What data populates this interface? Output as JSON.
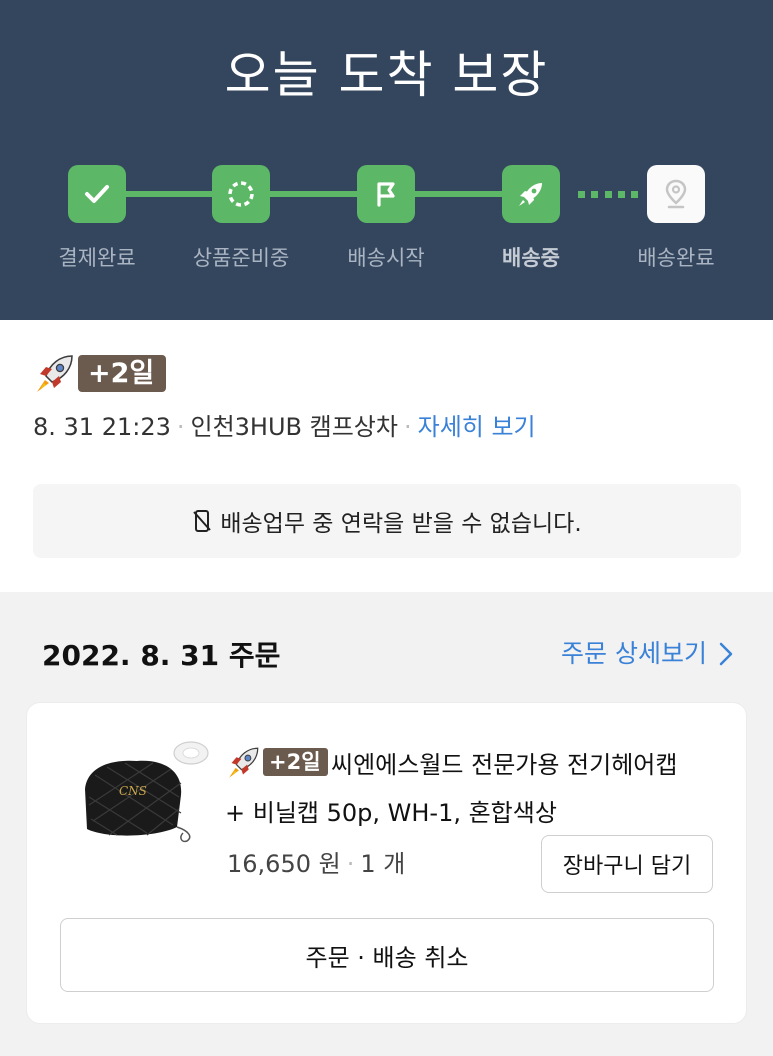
{
  "header": {
    "title": "오늘 도착 보장",
    "steps": [
      {
        "label": "결제완료",
        "icon": "check-icon",
        "state": "done"
      },
      {
        "label": "상품준비중",
        "icon": "loading-circle-icon",
        "state": "done"
      },
      {
        "label": "배송시작",
        "icon": "flag-icon",
        "state": "done"
      },
      {
        "label": "배송중",
        "icon": "rocket-icon",
        "state": "current"
      },
      {
        "label": "배송완료",
        "icon": "location-pin-icon",
        "state": "pending"
      }
    ],
    "colors": {
      "background": "#34465e",
      "progress": "#5cb866"
    }
  },
  "delivery": {
    "rocket_icon": "rocket-icon",
    "badge": "+2일",
    "datetime": "8. 31 21:23",
    "location": "인천3HUB 캠프상차",
    "detail_link": "자세히 보기",
    "notice_icon": "no-phone-icon",
    "notice": "배송업무 중 연락을 받을 수 없습니다."
  },
  "order": {
    "date_label": "2022. 8. 31 주문",
    "detail_link": "주문 상세보기",
    "detail_icon": "chevron-right-icon",
    "item": {
      "badge": "+2일",
      "name_line1": "씨엔에스월드 전문가용 전기헤어캡",
      "name_line2": "+ 비닐캡 50p, WH-1, 혼합색상",
      "price": "16,650 원",
      "quantity": "1 개",
      "cart_button": "장바구니 담기"
    },
    "cancel_button": "주문 · 배송 취소"
  }
}
